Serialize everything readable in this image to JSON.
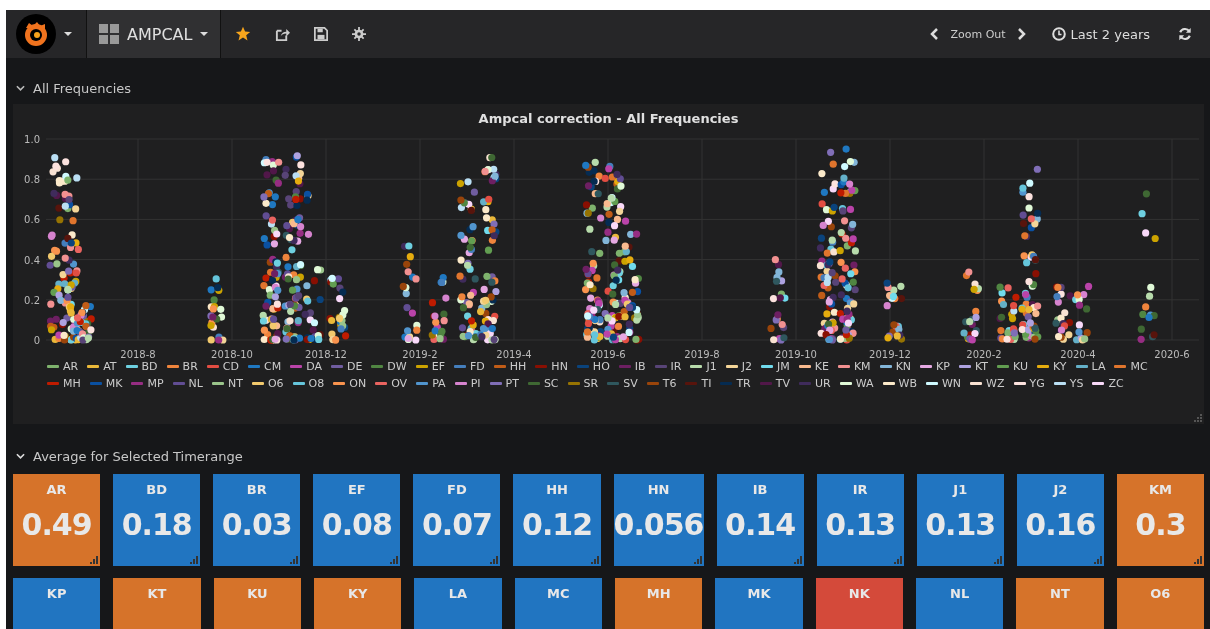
{
  "navbar": {
    "dashboard_title": "AMPCAL",
    "zoom_label": "Zoom Out",
    "time_range": "Last 2 years"
  },
  "sections": [
    {
      "title": "All Frequencies",
      "expanded": true
    },
    {
      "title": "Average for Selected Timerange",
      "expanded": true
    }
  ],
  "graph_panel": {
    "title": "Ampcal correction - All Frequencies",
    "y_axis_labels": [
      "1.0",
      "0.8",
      "0.6",
      "0.4",
      "0.2",
      "0"
    ],
    "x_axis_labels": [
      "2018-8",
      "2018-10",
      "2018-12",
      "2019-2",
      "2019-4",
      "2019-6",
      "2019-8",
      "2019-10",
      "2019-12",
      "2020-2",
      "2020-4",
      "2020-6"
    ],
    "legend": [
      {
        "name": "AR",
        "color": "#7eb26d"
      },
      {
        "name": "AT",
        "color": "#eab839"
      },
      {
        "name": "BD",
        "color": "#6ed0e0"
      },
      {
        "name": "BR",
        "color": "#ef843c"
      },
      {
        "name": "CD",
        "color": "#e24d42"
      },
      {
        "name": "CM",
        "color": "#1f78c1"
      },
      {
        "name": "DA",
        "color": "#ba43a9"
      },
      {
        "name": "DE",
        "color": "#705da0"
      },
      {
        "name": "DW",
        "color": "#508642"
      },
      {
        "name": "EF",
        "color": "#cca300"
      },
      {
        "name": "FD",
        "color": "#447ebc"
      },
      {
        "name": "HH",
        "color": "#c15c17"
      },
      {
        "name": "HN",
        "color": "#890f02"
      },
      {
        "name": "HO",
        "color": "#0a437c"
      },
      {
        "name": "IB",
        "color": "#6d1f62"
      },
      {
        "name": "IR",
        "color": "#584477"
      },
      {
        "name": "J1",
        "color": "#b7dbab"
      },
      {
        "name": "J2",
        "color": "#f4d598"
      },
      {
        "name": "JM",
        "color": "#70dbed"
      },
      {
        "name": "KE",
        "color": "#f9ba8f"
      },
      {
        "name": "KM",
        "color": "#f29191"
      },
      {
        "name": "KN",
        "color": "#82b5d8"
      },
      {
        "name": "KP",
        "color": "#e5a8e2"
      },
      {
        "name": "KT",
        "color": "#aea2e0"
      },
      {
        "name": "KU",
        "color": "#629e51"
      },
      {
        "name": "KY",
        "color": "#e5ac0e"
      },
      {
        "name": "LA",
        "color": "#64b0c8"
      },
      {
        "name": "MC",
        "color": "#e0752d"
      },
      {
        "name": "MH",
        "color": "#bf1b00"
      },
      {
        "name": "MK",
        "color": "#0a50a1"
      },
      {
        "name": "MP",
        "color": "#962d82"
      },
      {
        "name": "NL",
        "color": "#614d93"
      },
      {
        "name": "NT",
        "color": "#9ac48a"
      },
      {
        "name": "O6",
        "color": "#f2c96d"
      },
      {
        "name": "O8",
        "color": "#65c5db"
      },
      {
        "name": "ON",
        "color": "#f9934e"
      },
      {
        "name": "OV",
        "color": "#ea6460"
      },
      {
        "name": "PA",
        "color": "#5195ce"
      },
      {
        "name": "PI",
        "color": "#d683ce"
      },
      {
        "name": "PT",
        "color": "#806eb7"
      },
      {
        "name": "SC",
        "color": "#3f6833"
      },
      {
        "name": "SR",
        "color": "#967302"
      },
      {
        "name": "SV",
        "color": "#2f575e"
      },
      {
        "name": "T6",
        "color": "#99440a"
      },
      {
        "name": "TI",
        "color": "#58140c"
      },
      {
        "name": "TR",
        "color": "#052b51"
      },
      {
        "name": "TV",
        "color": "#511749"
      },
      {
        "name": "UR",
        "color": "#3f2b5b"
      },
      {
        "name": "WA",
        "color": "#e0f9d7"
      },
      {
        "name": "WB",
        "color": "#fceaca"
      },
      {
        "name": "WN",
        "color": "#cffaff"
      },
      {
        "name": "WZ",
        "color": "#f9e2d2"
      },
      {
        "name": "YG",
        "color": "#fce2de"
      },
      {
        "name": "YS",
        "color": "#badff4"
      },
      {
        "name": "ZC",
        "color": "#f9d9f9"
      }
    ]
  },
  "stat_tiles": [
    {
      "label": "AR",
      "value": "0.49",
      "color": "#d6732a"
    },
    {
      "label": "BD",
      "value": "0.18",
      "color": "#2175c1"
    },
    {
      "label": "BR",
      "value": "0.03",
      "color": "#2175c1"
    },
    {
      "label": "EF",
      "value": "0.08",
      "color": "#2175c1"
    },
    {
      "label": "FD",
      "value": "0.07",
      "color": "#2175c1"
    },
    {
      "label": "HH",
      "value": "0.12",
      "color": "#2175c1"
    },
    {
      "label": "HN",
      "value": "0.056",
      "color": "#2175c1"
    },
    {
      "label": "IB",
      "value": "0.14",
      "color": "#2175c1"
    },
    {
      "label": "IR",
      "value": "0.13",
      "color": "#2175c1"
    },
    {
      "label": "J1",
      "value": "0.13",
      "color": "#2175c1"
    },
    {
      "label": "J2",
      "value": "0.16",
      "color": "#2175c1"
    },
    {
      "label": "KM",
      "value": "0.3",
      "color": "#d6732a"
    },
    {
      "label": "KP",
      "color": "#2175c1"
    },
    {
      "label": "KT",
      "color": "#d6732a"
    },
    {
      "label": "KU",
      "color": "#d6732a"
    },
    {
      "label": "KY",
      "color": "#d6732a"
    },
    {
      "label": "LA",
      "color": "#2175c1"
    },
    {
      "label": "MC",
      "color": "#2175c1"
    },
    {
      "label": "MH",
      "color": "#d6732a"
    },
    {
      "label": "MK",
      "color": "#2175c1"
    },
    {
      "label": "NK",
      "color": "#d44a3a"
    },
    {
      "label": "NL",
      "color": "#2175c1"
    },
    {
      "label": "NT",
      "color": "#d6732a"
    },
    {
      "label": "O6",
      "color": "#d6732a"
    }
  ]
}
